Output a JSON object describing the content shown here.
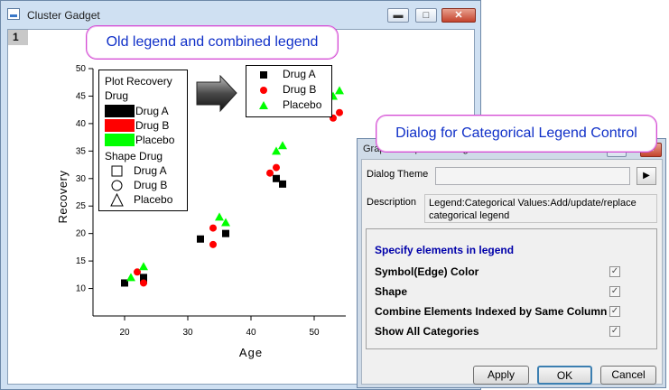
{
  "window": {
    "title": "Cluster Gadget",
    "page_tab": "1",
    "buttons": {
      "minimize": "▬",
      "maximize": "□",
      "close": "✕"
    }
  },
  "callouts": {
    "legend": "Old legend and combined legend",
    "dialog": "Dialog for Categorical Legend Control"
  },
  "chart_data": {
    "type": "scatter",
    "xlabel": "Age",
    "ylabel": "Recovery",
    "xlim": [
      15,
      55
    ],
    "ylim": [
      5,
      50
    ],
    "xticks": [
      20,
      30,
      40,
      50
    ],
    "yticks": [
      10,
      15,
      20,
      25,
      30,
      35,
      40,
      45,
      50
    ],
    "grid": false,
    "series": [
      {
        "name": "Drug A",
        "marker": "square",
        "color": "#000000",
        "points": [
          [
            20,
            11
          ],
          [
            23,
            12
          ],
          [
            23,
            11.5
          ],
          [
            32,
            19
          ],
          [
            36,
            20
          ],
          [
            44,
            30
          ],
          [
            45,
            29
          ]
        ]
      },
      {
        "name": "Drug B",
        "marker": "circle",
        "color": "#ff0000",
        "points": [
          [
            22,
            13
          ],
          [
            23,
            11
          ],
          [
            34,
            21
          ],
          [
            34,
            18
          ],
          [
            43,
            31
          ],
          [
            44,
            32
          ],
          [
            53,
            41
          ],
          [
            54,
            42
          ]
        ]
      },
      {
        "name": "Placebo",
        "marker": "triangle",
        "color": "#00ff00",
        "points": [
          [
            21,
            12
          ],
          [
            23,
            14
          ],
          [
            35,
            23
          ],
          [
            36,
            22
          ],
          [
            44,
            35
          ],
          [
            45,
            36
          ],
          [
            53,
            45
          ],
          [
            54,
            46
          ]
        ]
      }
    ],
    "old_legend": {
      "title_line1": "Plot Recovery",
      "title_line2": "Drug",
      "color_items": [
        {
          "label": "Drug A",
          "color": "#000000"
        },
        {
          "label": "Drug B",
          "color": "#ff0000"
        },
        {
          "label": "Placebo",
          "color": "#00ff00"
        }
      ],
      "shape_title": "Shape  Drug",
      "shape_items": [
        {
          "label": "Drug A",
          "shape": "square"
        },
        {
          "label": "Drug B",
          "shape": "circle"
        },
        {
          "label": "Placebo",
          "shape": "triangle"
        }
      ]
    },
    "combined_legend": [
      {
        "label": "Drug A",
        "marker": "square",
        "color": "#000000"
      },
      {
        "label": "Drug B",
        "marker": "circle",
        "color": "#ff0000"
      },
      {
        "label": "Placebo",
        "marker": "triangle",
        "color": "#00ff00"
      }
    ]
  },
  "dialog": {
    "title": "Graph Manipulation: legendcc",
    "theme_label": "Dialog Theme",
    "theme_value": "",
    "theme_arrow": "▶",
    "description_label": "Description",
    "description_text": "Legend:Categorical Values:Add/update/replace categorical legend",
    "section_title": "Specify elements in legend",
    "options": [
      {
        "label": "Symbol(Edge) Color",
        "checked": true
      },
      {
        "label": "Shape",
        "checked": true
      },
      {
        "label": "Combine Elements Indexed by Same Column",
        "checked": true
      },
      {
        "label": "Show All Categories",
        "checked": true
      }
    ],
    "buttons": {
      "apply": "Apply",
      "ok": "OK",
      "cancel": "Cancel"
    },
    "close": "✕",
    "min": "▬"
  },
  "icons": {
    "arrow": "arrow-right-icon"
  },
  "colors": {
    "callout_border": "#d44bd4",
    "callout_text": "#1030c8",
    "section_title": "#0000aa"
  }
}
